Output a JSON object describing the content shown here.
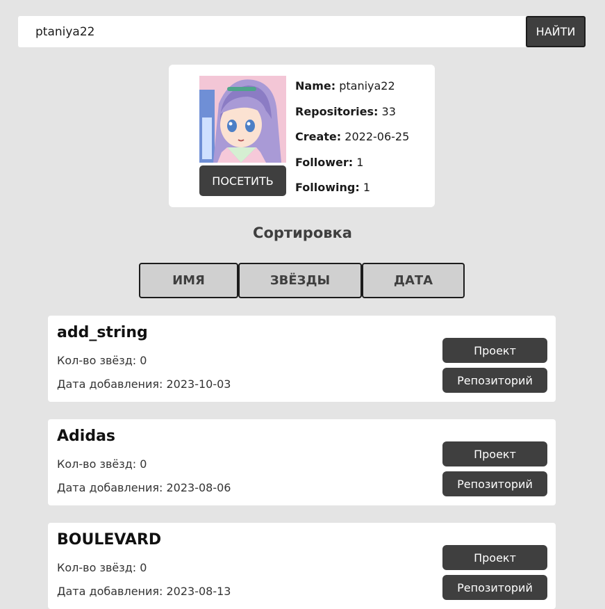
{
  "search": {
    "value": "ptaniya22",
    "button_label": "НАЙТИ"
  },
  "profile": {
    "visit_label": "ПОСЕТИТЬ",
    "fields": [
      {
        "key": "Name:",
        "value": "ptaniya22"
      },
      {
        "key": "Repositories:",
        "value": "33"
      },
      {
        "key": "Create:",
        "value": "2022-06-25"
      },
      {
        "key": "Follower:",
        "value": "1"
      },
      {
        "key": "Following:",
        "value": "1"
      }
    ]
  },
  "sort": {
    "title": "Сортировка",
    "buttons": [
      "ИМЯ",
      "ЗВЁЗДЫ",
      "ДАТА"
    ]
  },
  "repos": [
    {
      "name": "add_string",
      "stars": "Кол-во звёзд: 0",
      "date": "Дата добавления: 2023-10-03",
      "project_label": "Проект",
      "repo_label": "Репозиторий"
    },
    {
      "name": "Adidas",
      "stars": "Кол-во звёзд: 0",
      "date": "Дата добавления: 2023-08-06",
      "project_label": "Проект",
      "repo_label": "Репозиторий"
    },
    {
      "name": "BOULEVARD",
      "stars": "Кол-во звёзд: 0",
      "date": "Дата добавления: 2023-08-13",
      "project_label": "Проект",
      "repo_label": "Репозиторий"
    }
  ]
}
